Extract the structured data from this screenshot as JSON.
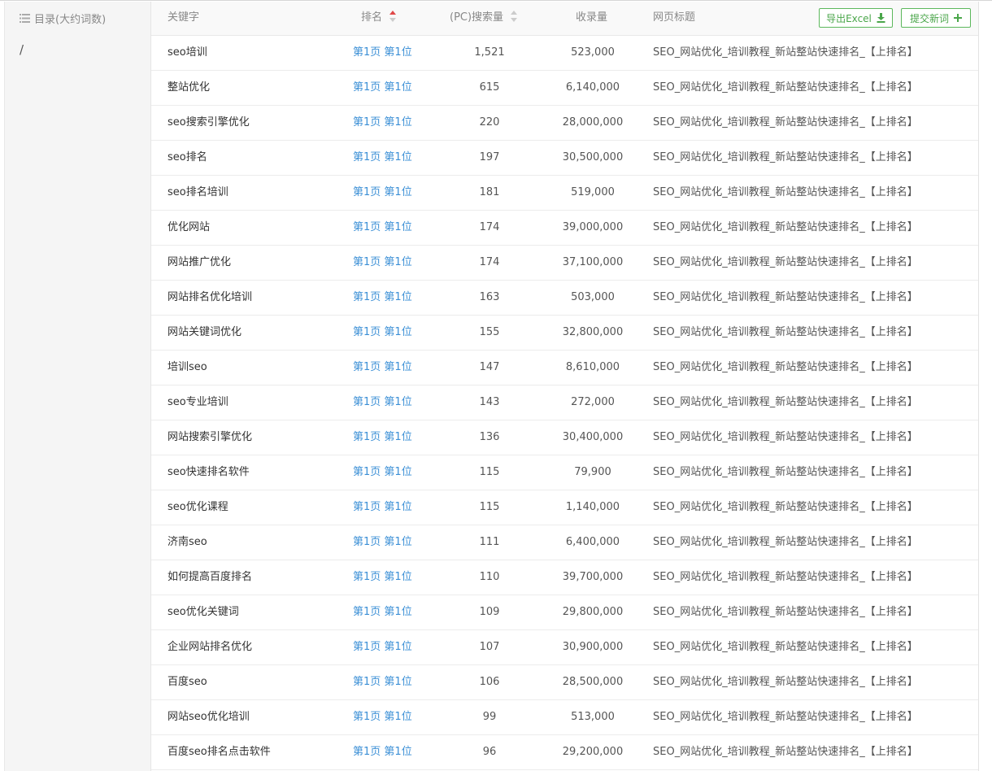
{
  "sidebar": {
    "title": "目录(大约词数)",
    "path": "/"
  },
  "table": {
    "headers": {
      "keyword": "关键字",
      "rank": "排名",
      "search_volume": "(PC)搜索量",
      "indexed": "收录量",
      "page_title": "网页标题"
    },
    "buttons": {
      "export": "导出Excel",
      "submit": "提交新词"
    },
    "rows": [
      {
        "keyword": "seo培训",
        "page": "第1页",
        "position": "第1位",
        "search": "1,521",
        "indexed": "523,000",
        "title": "SEO_网站优化_培训教程_新站整站快速排名_【上排名】"
      },
      {
        "keyword": "整站优化",
        "page": "第1页",
        "position": "第1位",
        "search": "615",
        "indexed": "6,140,000",
        "title": "SEO_网站优化_培训教程_新站整站快速排名_【上排名】"
      },
      {
        "keyword": "seo搜索引擎优化",
        "page": "第1页",
        "position": "第1位",
        "search": "220",
        "indexed": "28,000,000",
        "title": "SEO_网站优化_培训教程_新站整站快速排名_【上排名】"
      },
      {
        "keyword": "seo排名",
        "page": "第1页",
        "position": "第1位",
        "search": "197",
        "indexed": "30,500,000",
        "title": "SEO_网站优化_培训教程_新站整站快速排名_【上排名】"
      },
      {
        "keyword": "seo排名培训",
        "page": "第1页",
        "position": "第1位",
        "search": "181",
        "indexed": "519,000",
        "title": "SEO_网站优化_培训教程_新站整站快速排名_【上排名】"
      },
      {
        "keyword": "优化网站",
        "page": "第1页",
        "position": "第1位",
        "search": "174",
        "indexed": "39,000,000",
        "title": "SEO_网站优化_培训教程_新站整站快速排名_【上排名】"
      },
      {
        "keyword": "网站推广优化",
        "page": "第1页",
        "position": "第1位",
        "search": "174",
        "indexed": "37,100,000",
        "title": "SEO_网站优化_培训教程_新站整站快速排名_【上排名】"
      },
      {
        "keyword": "网站排名优化培训",
        "page": "第1页",
        "position": "第1位",
        "search": "163",
        "indexed": "503,000",
        "title": "SEO_网站优化_培训教程_新站整站快速排名_【上排名】"
      },
      {
        "keyword": "网站关键词优化",
        "page": "第1页",
        "position": "第1位",
        "search": "155",
        "indexed": "32,800,000",
        "title": "SEO_网站优化_培训教程_新站整站快速排名_【上排名】"
      },
      {
        "keyword": "培训seo",
        "page": "第1页",
        "position": "第1位",
        "search": "147",
        "indexed": "8,610,000",
        "title": "SEO_网站优化_培训教程_新站整站快速排名_【上排名】"
      },
      {
        "keyword": "seo专业培训",
        "page": "第1页",
        "position": "第1位",
        "search": "143",
        "indexed": "272,000",
        "title": "SEO_网站优化_培训教程_新站整站快速排名_【上排名】"
      },
      {
        "keyword": "网站搜索引擎优化",
        "page": "第1页",
        "position": "第1位",
        "search": "136",
        "indexed": "30,400,000",
        "title": "SEO_网站优化_培训教程_新站整站快速排名_【上排名】"
      },
      {
        "keyword": "seo快速排名软件",
        "page": "第1页",
        "position": "第1位",
        "search": "115",
        "indexed": "79,900",
        "title": "SEO_网站优化_培训教程_新站整站快速排名_【上排名】"
      },
      {
        "keyword": "seo优化课程",
        "page": "第1页",
        "position": "第1位",
        "search": "115",
        "indexed": "1,140,000",
        "title": "SEO_网站优化_培训教程_新站整站快速排名_【上排名】"
      },
      {
        "keyword": "济南seo",
        "page": "第1页",
        "position": "第1位",
        "search": "111",
        "indexed": "6,400,000",
        "title": "SEO_网站优化_培训教程_新站整站快速排名_【上排名】"
      },
      {
        "keyword": "如何提高百度排名",
        "page": "第1页",
        "position": "第1位",
        "search": "110",
        "indexed": "39,700,000",
        "title": "SEO_网站优化_培训教程_新站整站快速排名_【上排名】"
      },
      {
        "keyword": "seo优化关键词",
        "page": "第1页",
        "position": "第1位",
        "search": "109",
        "indexed": "29,800,000",
        "title": "SEO_网站优化_培训教程_新站整站快速排名_【上排名】"
      },
      {
        "keyword": "企业网站排名优化",
        "page": "第1页",
        "position": "第1位",
        "search": "107",
        "indexed": "30,900,000",
        "title": "SEO_网站优化_培训教程_新站整站快速排名_【上排名】"
      },
      {
        "keyword": "百度seo",
        "page": "第1页",
        "position": "第1位",
        "search": "106",
        "indexed": "28,500,000",
        "title": "SEO_网站优化_培训教程_新站整站快速排名_【上排名】"
      },
      {
        "keyword": "网站seo优化培训",
        "page": "第1页",
        "position": "第1位",
        "search": "99",
        "indexed": "513,000",
        "title": "SEO_网站优化_培训教程_新站整站快速排名_【上排名】"
      },
      {
        "keyword": "百度seo排名点击软件",
        "page": "第1页",
        "position": "第1位",
        "search": "96",
        "indexed": "29,200,000",
        "title": "SEO_网站优化_培训教程_新站整站快速排名_【上排名】"
      }
    ]
  },
  "icons": {
    "list": "list-icon",
    "sort_active": "sort-asc-icon",
    "sort_inactive": "sort-icon",
    "download": "download-icon",
    "plus": "plus-icon"
  },
  "colors": {
    "link": "#3b8fd6",
    "button_border": "#5cb85c",
    "button_text": "#4aa64a",
    "sort_active": "#e04848",
    "sort_inactive": "#cccccc",
    "header_bg": "#f9f9f9",
    "sidebar_bg": "#f5f5f5"
  }
}
